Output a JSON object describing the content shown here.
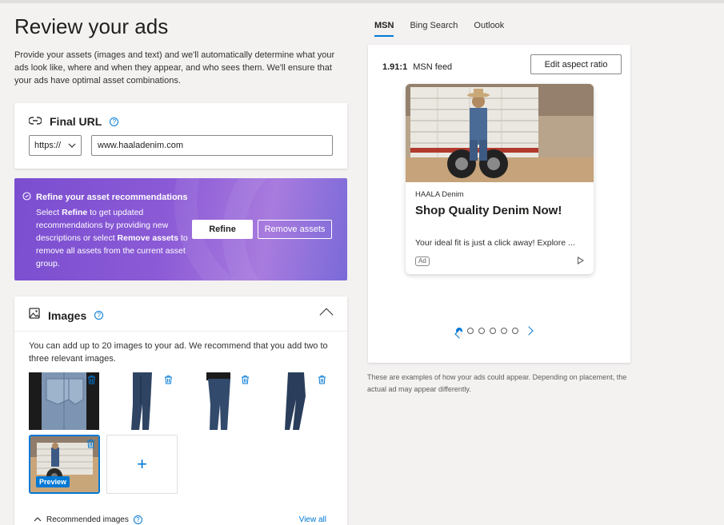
{
  "page": {
    "title": "Review your ads",
    "intro": "Provide your assets (images and text) and we'll automatically determine what your ads look like, where and when they appear, and who sees them. We'll ensure that your ads have optimal asset combinations."
  },
  "final_url": {
    "label": "Final URL",
    "protocol": "https://",
    "url": "www.haaladenim.com"
  },
  "refine": {
    "title": "Refine your asset recommendations",
    "text_1": "Select ",
    "text_refine": "Refine",
    "text_2": " to get updated recommendations by providing new descriptions or select ",
    "text_remove": "Remove assets",
    "text_3": " to remove all assets from the current asset group.",
    "refine_button": "Refine",
    "remove_button": "Remove assets"
  },
  "images": {
    "label": "Images",
    "description": "You can add up to 20 images to your ad. We recommend that you add two to three relevant images.",
    "preview_badge": "Preview",
    "add_symbol": "+",
    "recommended_label": "Recommended images",
    "view_all": "View all"
  },
  "preview": {
    "tabs": [
      "MSN",
      "Bing Search",
      "Outlook"
    ],
    "ratio": "1.91:1",
    "placement": "MSN feed",
    "aspect_button": "Edit aspect ratio",
    "ad": {
      "brand": "HAALA Denim",
      "headline": "Shop Quality Denim Now!",
      "description": "Your ideal fit is just a click away! Explore ...",
      "badge": "Ad"
    },
    "pager": {
      "total": 6,
      "current": 1
    },
    "disclaimer": "These are examples of how your ads could appear. Depending on placement, the actual ad may appear differently."
  },
  "colors": {
    "accent": "#0078d4",
    "refine_gradient_start": "#7a4ed0",
    "refine_gradient_end": "#a87bde"
  },
  "icons": {
    "link": "link-icon",
    "help": "help-icon",
    "sparkle": "sparkle-icon",
    "image": "image-icon",
    "trash": "trash-icon",
    "chevron": "chevron-icon"
  }
}
